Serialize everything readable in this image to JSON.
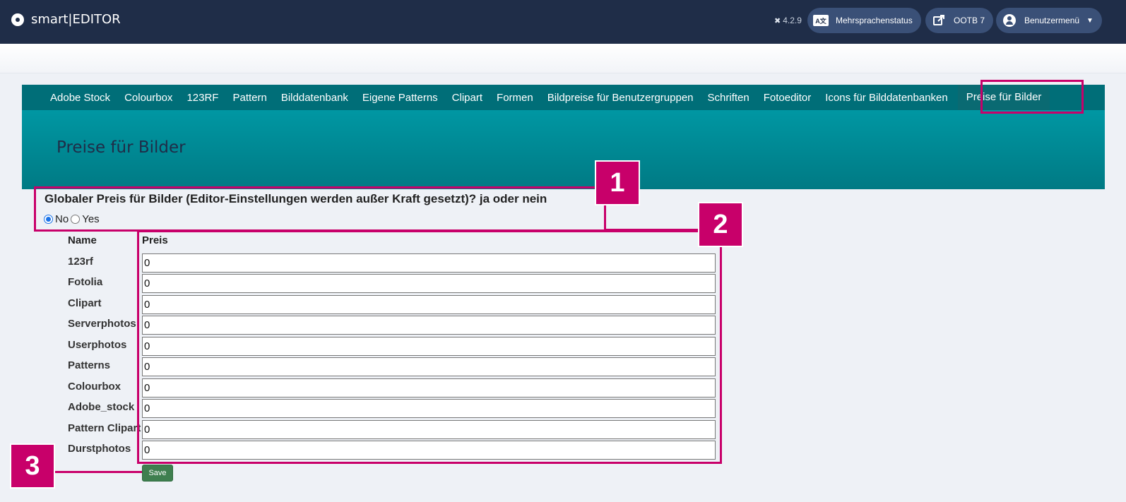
{
  "header": {
    "brand": "smart|EDITOR",
    "version": "4.2.9",
    "buttons": [
      {
        "label": "Mehrsprachenstatus",
        "icon": "language-icon"
      },
      {
        "label": "OOTB 7",
        "icon": "external-link-icon"
      },
      {
        "label": "Benutzermenü",
        "icon": "user-icon"
      }
    ]
  },
  "nav": {
    "items": [
      "Adobe Stock",
      "Colourbox",
      "123RF",
      "Pattern",
      "Bilddatenbank",
      "Eigene Patterns",
      "Clipart",
      "Formen",
      "Bildpreise für Benutzergruppen",
      "Schriften",
      "Fotoeditor",
      "Icons für Bilddatenbanken",
      "Preise für Bilder"
    ],
    "active": "Preise für Bilder"
  },
  "page": {
    "title": "Preise für Bilder"
  },
  "global_price": {
    "question": "Globaler Preis für Bilder (Editor-Einstellungen werden außer Kraft gesetzt)? ja oder nein",
    "options": [
      "No",
      "Yes"
    ],
    "selected": "No"
  },
  "table": {
    "headers": [
      "Name",
      "Preis"
    ],
    "rows": [
      {
        "name": "123rf",
        "price": "0"
      },
      {
        "name": "Fotolia",
        "price": "0"
      },
      {
        "name": "Clipart",
        "price": "0"
      },
      {
        "name": "Serverphotos",
        "price": "0"
      },
      {
        "name": "Userphotos",
        "price": "0"
      },
      {
        "name": "Patterns",
        "price": "0"
      },
      {
        "name": "Colourbox",
        "price": "0"
      },
      {
        "name": "Adobe_stock",
        "price": "0"
      },
      {
        "name": "Pattern Clipart",
        "price": "0"
      },
      {
        "name": "Durstphotos",
        "price": "0"
      }
    ]
  },
  "save_label": "Save",
  "annotations": [
    "1",
    "2",
    "3"
  ],
  "colors": {
    "header_bg": "#1f2d48",
    "nav_bg": "#006e78",
    "annotation": "#c8006a",
    "save_button": "#3f7f4f"
  }
}
